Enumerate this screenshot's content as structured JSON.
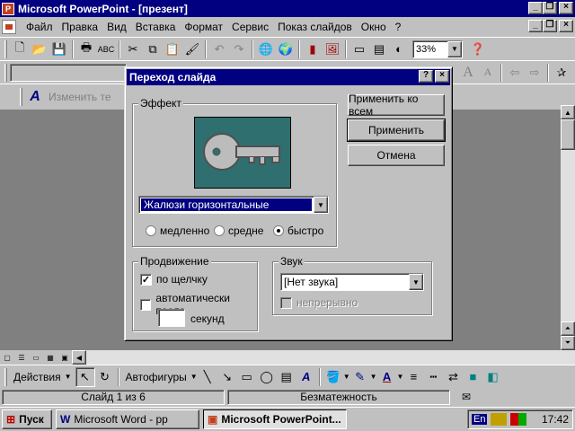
{
  "app": {
    "title": "Microsoft PowerPoint - [презент]",
    "icon_letter": "P"
  },
  "menu": [
    "Файл",
    "Правка",
    "Вид",
    "Вставка",
    "Формат",
    "Сервис",
    "Показ слайдов",
    "Окно",
    "?"
  ],
  "toolbar": {
    "zoom": "33%",
    "text_hint": "Изменить те"
  },
  "dialog": {
    "title": "Переход слайда",
    "help_btn": "?",
    "close_btn": "×",
    "effect_group": "Эффект",
    "effect_value": "Жалюзи горизонтальные",
    "speed": {
      "slow": "медленно",
      "medium": "средне",
      "fast": "быстро",
      "selected": "fast"
    },
    "buttons": {
      "apply_all": "Применить ко всем",
      "apply": "Применить",
      "cancel": "Отмена"
    },
    "advance_group": "Продвижение",
    "on_click": "по щелчку",
    "on_click_checked": true,
    "auto_after": "автоматически после",
    "auto_after_checked": false,
    "seconds_value": "",
    "seconds_label": "секунд",
    "sound_group": "Звук",
    "sound_value": "[Нет звука]",
    "loop_label": "непрерывно"
  },
  "drawing": {
    "actions": "Действия",
    "autoshapes": "Автофигуры"
  },
  "status": {
    "slide": "Слайд 1 из 6",
    "design": "Безматежность"
  },
  "taskbar": {
    "start": "Пуск",
    "word_task": "Microsoft Word - pp",
    "ppt_task": "Microsoft PowerPoint...",
    "lang": "En",
    "clock": "17:42"
  },
  "colors": {
    "titlebar": "#000080",
    "face": "#c0c0c0",
    "workspace": "#808080",
    "preview_bg": "#2f6f6f"
  }
}
